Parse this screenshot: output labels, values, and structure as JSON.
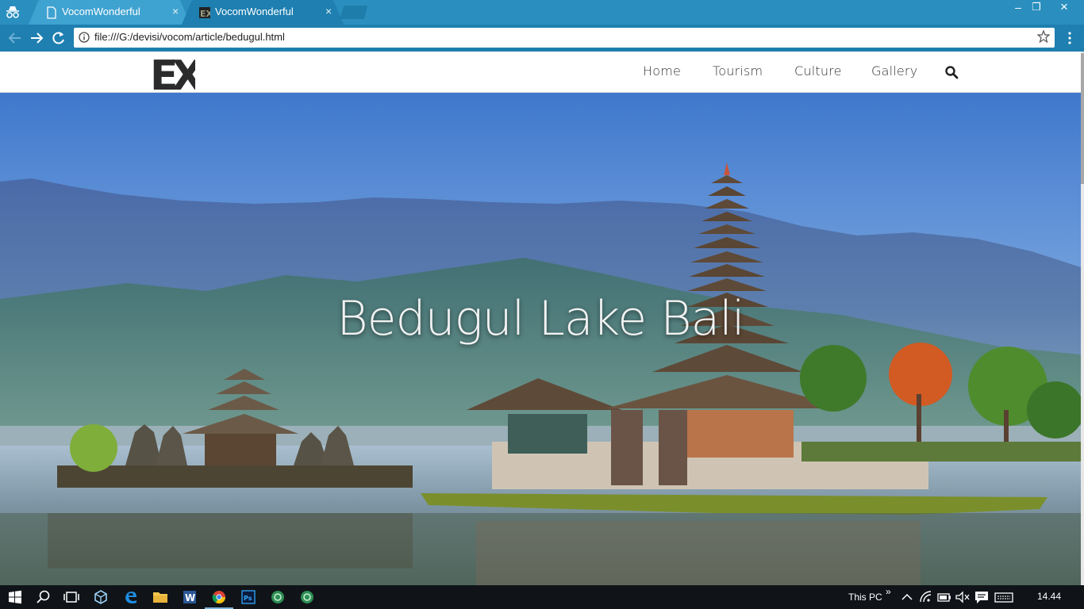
{
  "browser": {
    "tabs": [
      {
        "title": "VocomWonderful",
        "active": false
      },
      {
        "title": "VocomWonderful",
        "active": true
      }
    ],
    "tab_close_glyph": "×",
    "url": "file:///G:/devisi/vocom/article/bedugul.html",
    "window_controls": {
      "minimize": "–",
      "maximize": "❐",
      "close": "×"
    },
    "colors": {
      "tabstrip": "#2a8fbf",
      "toolbar": "#1e7fb0"
    }
  },
  "site": {
    "logo_text": "EX",
    "nav": [
      {
        "label": "Home"
      },
      {
        "label": "Tourism"
      },
      {
        "label": "Culture"
      },
      {
        "label": "Gallery"
      }
    ],
    "hero_title": "Bedugul Lake Bali"
  },
  "taskbar": {
    "apps": [
      "start",
      "search",
      "task-view",
      "store",
      "edge",
      "file-explorer",
      "word",
      "chrome",
      "photoshop",
      "app-green-1",
      "app-green-2"
    ],
    "tray_label": "This PC",
    "tray_chevron": "»",
    "clock": "14.44"
  }
}
